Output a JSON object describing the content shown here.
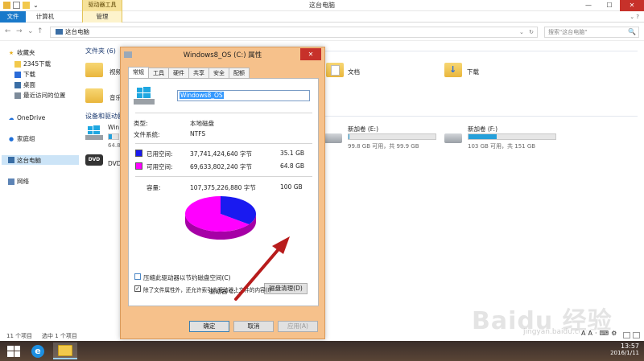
{
  "window": {
    "title": "这台电脑",
    "context_tab_group": "驱动器工具",
    "min": "—",
    "max": "☐",
    "close": "✕"
  },
  "ribbon": {
    "tabs": [
      "文件",
      "计算机",
      "管理"
    ],
    "expand": "⌄ ?"
  },
  "address": {
    "back": "←",
    "forward": "→",
    "recent": "⌄",
    "up": "↑",
    "path": "这台电脑",
    "dropdown": "⌄",
    "refresh": "↻",
    "search_placeholder": "搜索\"这台电脑\"",
    "search_icon": "🔍"
  },
  "nav": {
    "favorites": "收藏夹",
    "fav_items": [
      "2345下载",
      "下载",
      "桌面",
      "最近访问的位置"
    ],
    "onedrive": "OneDrive",
    "homegroup": "家庭组",
    "thispc": "这台电脑",
    "network": "网络"
  },
  "content": {
    "folders_title": "文件夹 (6)",
    "folders": [
      "视频",
      "音乐",
      "文档",
      "下载"
    ],
    "devices_title": "设备和驱动器",
    "drive_c_name": "Win",
    "drive_c_free": "64.8",
    "dvd_label": "DVD",
    "dvd_name": "DVD",
    "drive_e": {
      "name": "新加卷 (E:)",
      "free": "99.8 GB 可用，共 99.9 GB",
      "used_fraction": 0.01
    },
    "drive_f": {
      "name": "新加卷 (F:)",
      "free": "103 GB 可用，共 151 GB",
      "used_fraction": 0.32
    },
    "drive_c_used_fraction": 0.35
  },
  "status": {
    "count": "11 个项目",
    "selected": "选中 1 个项目"
  },
  "dialog": {
    "title": "Windows8_OS (C:) 属性",
    "close": "✕",
    "tabs": [
      "常规",
      "工具",
      "硬件",
      "共享",
      "安全",
      "配额"
    ],
    "volume_name": "Windows8_OS",
    "type_label": "类型:",
    "type_value": "本地磁盘",
    "fs_label": "文件系统:",
    "fs_value": "NTFS",
    "used_label": "已用空间:",
    "used_bytes": "37,741,424,640 字节",
    "used_gb": "35.1 GB",
    "free_label": "可用空间:",
    "free_bytes": "69,633,802,240 字节",
    "free_gb": "64.8 GB",
    "cap_label": "容量:",
    "cap_bytes": "107,375,226,880 字节",
    "cap_gb": "100 GB",
    "drive_label": "驱动器 C:",
    "cleanup": "磁盘清理(D)",
    "compress": "压缩此驱动器以节约磁盘空间(C)",
    "index": "除了文件属性外，还允许索引此驱动器上文件的内容(I)",
    "index_checked": "✓",
    "ok": "确定",
    "cancel": "取消",
    "apply": "应用(A)",
    "colors": {
      "used": "#1a1af0",
      "free": "#ff00ff"
    }
  },
  "chart_data": {
    "type": "pie",
    "labels": [
      "已用空间",
      "可用空间"
    ],
    "values": [
      35.1,
      64.8
    ],
    "colors": [
      "#1a1af0",
      "#ff00ff"
    ]
  },
  "taskbar": {
    "time": "13:57",
    "date": "2016/1/11",
    "ime": [
      "A",
      "A",
      "·",
      "⌨",
      "⚙"
    ]
  },
  "watermark": {
    "brand": "Baidu 经验",
    "sub": "jingyan.baidu.com"
  },
  "theme": {
    "accent": "#1979ca",
    "bar_fill": "#26a0da",
    "dialog_border": "#f6c18b"
  }
}
